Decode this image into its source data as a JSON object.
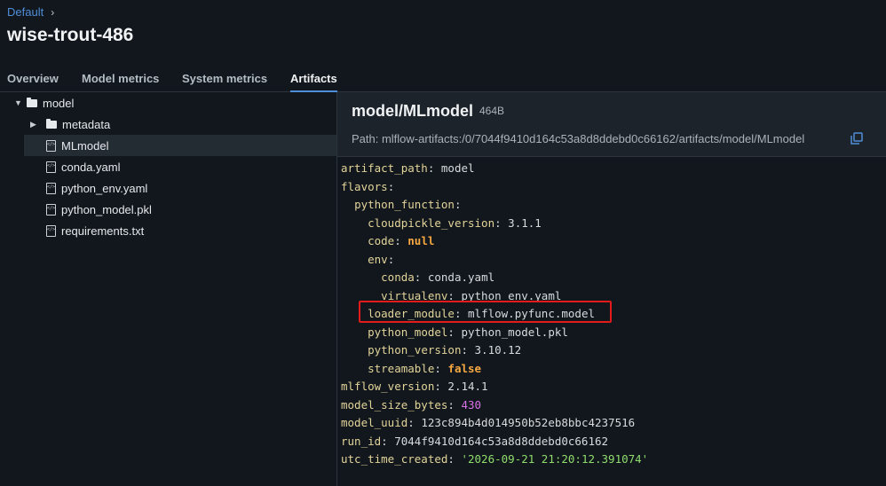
{
  "breadcrumb": {
    "root": "Default"
  },
  "run_title": "wise-trout-486",
  "tabs": [
    "Overview",
    "Model metrics",
    "System metrics",
    "Artifacts"
  ],
  "active_tab": "Artifacts",
  "tree": {
    "root": "model",
    "children": [
      "metadata",
      "MLmodel",
      "conda.yaml",
      "python_env.yaml",
      "python_model.pkl",
      "requirements.txt"
    ],
    "selected": "MLmodel"
  },
  "artifact": {
    "name": "model/MLmodel",
    "size": "464B",
    "path": "Path: mlflow-artifacts:/0/7044f9410d164c53a8d8ddebd0c66162/artifacts/model/MLmodel"
  },
  "yaml": {
    "artifact_path_key": "artifact_path",
    "artifact_path_val": "model",
    "flavors_key": "flavors",
    "python_function_key": "python_function",
    "cloudpickle_key": "cloudpickle_version",
    "cloudpickle_val": "3.1.1",
    "code_key": "code",
    "code_val": "null",
    "env_key": "env",
    "conda_key": "conda",
    "conda_val": "conda.yaml",
    "virtualenv_key": "virtualenv",
    "virtualenv_val": "python_env.yaml",
    "loader_key": "loader_module",
    "loader_val": "mlflow.pyfunc.model",
    "python_model_key": "python_model",
    "python_model_val": "python_model.pkl",
    "python_version_key": "python_version",
    "python_version_val": "3.10.12",
    "streamable_key": "streamable",
    "streamable_val": "false",
    "mlflow_version_key": "mlflow_version",
    "mlflow_version_val": "2.14.1",
    "model_size_key": "model_size_bytes",
    "model_size_val": "430",
    "model_uuid_key": "model_uuid",
    "model_uuid_val": "123c894b4d014950b52eb8bbc4237516",
    "run_id_key": "run_id",
    "run_id_val": "7044f9410d164c53a8d8ddebd0c66162",
    "utc_key": "utc_time_created",
    "utc_val": "'2026-09-21 21:20:12.391074'"
  },
  "colors": {
    "accent": "#4f8ed8",
    "highlight_box": "#e31b1b"
  }
}
